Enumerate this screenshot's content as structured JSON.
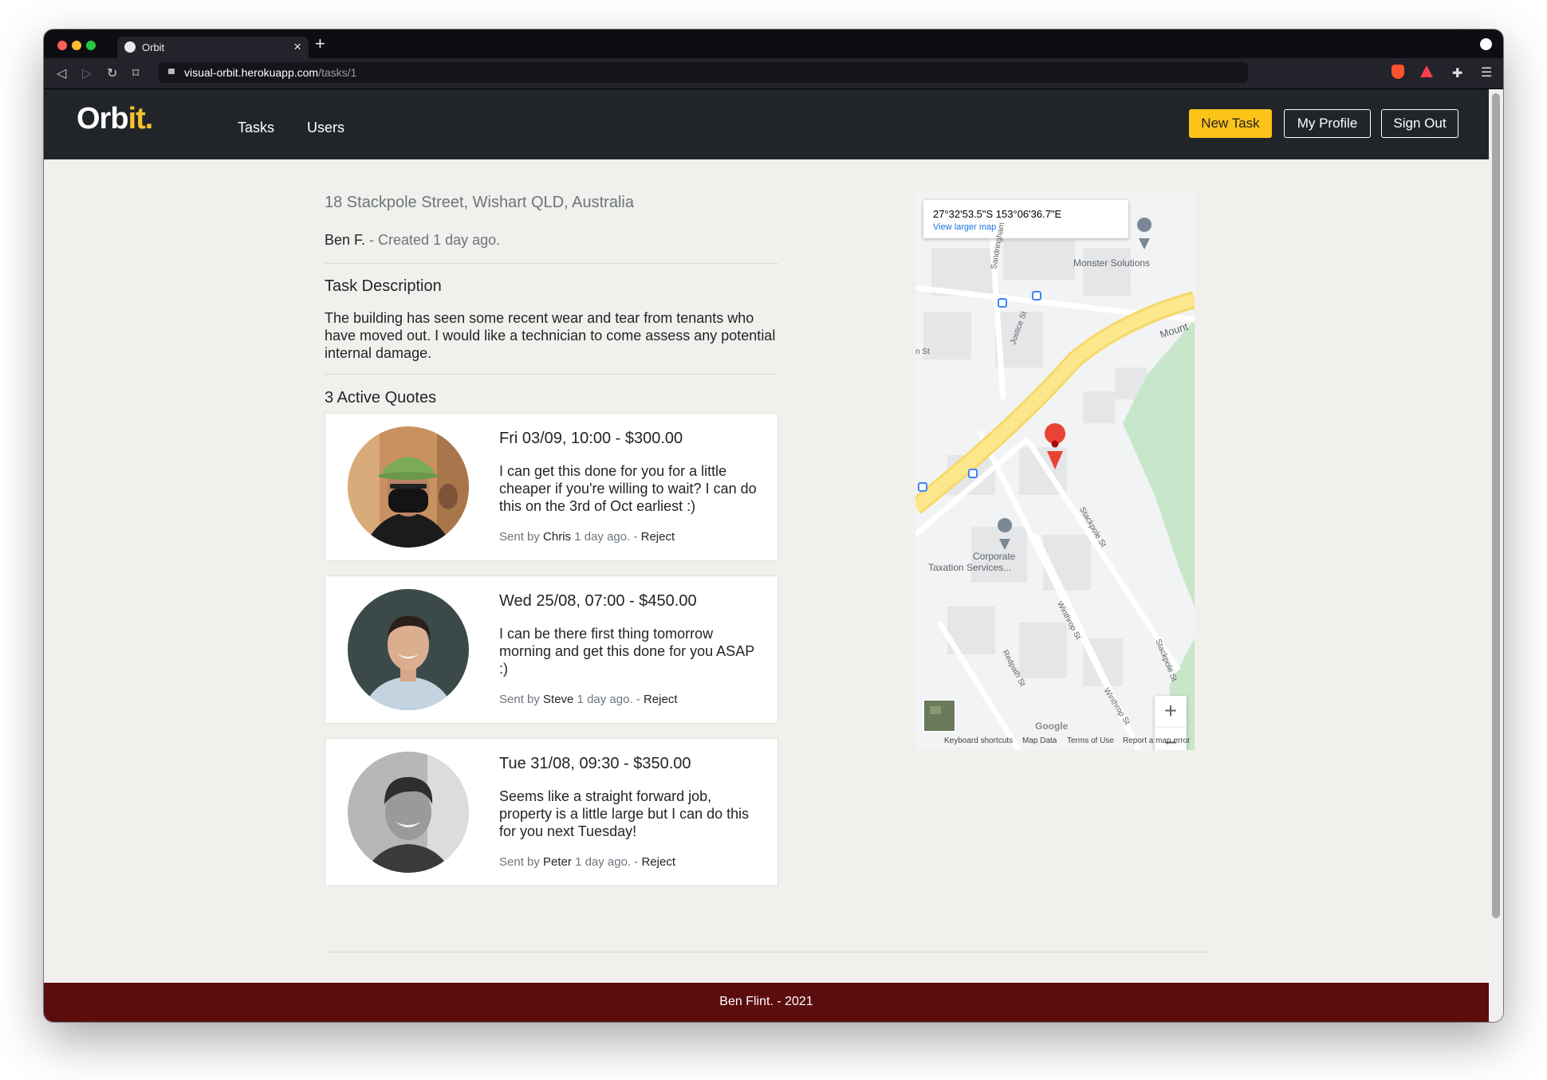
{
  "browser": {
    "tab_title": "Orbit",
    "url_host": "visual-orbit.herokuapp.com",
    "url_path": "/tasks/1"
  },
  "nav": {
    "logo_main": "Orb",
    "logo_accent": "it",
    "logo_dot": ".",
    "links": [
      "Tasks",
      "Users"
    ],
    "new_task": "New Task",
    "my_profile": "My Profile",
    "sign_out": "Sign Out"
  },
  "task": {
    "address": "18 Stackpole Street, Wishart QLD, Australia",
    "author": "Ben F.",
    "created": " - Created 1 day ago.",
    "description_heading": "Task Description",
    "description": "The building has seen some recent wear and tear from tenants who have moved out. I would like a technician to come assess any potential internal damage.",
    "quotes_heading": "3 Active Quotes"
  },
  "quotes": [
    {
      "title": "Fri 03/09, 10:00 - $300.00",
      "message": "I can get this done for you for a little cheaper if you're willing to wait? I can do this on the 3rd of Oct earliest :)",
      "sent_by": "Sent by ",
      "sender": "Chris",
      "age": " 1 day ago. - ",
      "reject": "Reject"
    },
    {
      "title": "Wed 25/08, 07:00 - $450.00",
      "message": "I can be there first thing tomorrow morning and get this done for you ASAP :)",
      "sent_by": "Sent by ",
      "sender": "Steve",
      "age": " 1 day ago. - ",
      "reject": "Reject"
    },
    {
      "title": "Tue 31/08, 09:30 - $350.00",
      "message": "Seems like a straight forward job, property is a little large but I can do this for you next Tuesday!",
      "sent_by": "Sent by ",
      "sender": "Peter",
      "age": " 1 day ago. - ",
      "reject": "Reject"
    }
  ],
  "map": {
    "coords": "27°32'53.5\"S 153°06'36.7\"E",
    "view_larger": "View larger map",
    "poi_1": "Monster Solutions",
    "poi_2a": "Corporate",
    "poi_2b": "Taxation Services...",
    "road_mount": "Mount",
    "road_justice": "Justice St",
    "road_stackpole_1": "Stackpole St",
    "road_stackpole_2": "Stackpole St",
    "road_winthrop_1": "Winthrop St",
    "road_winthrop_2": "Winthrop St",
    "road_redpath": "Redpath St",
    "road_sandringham": "Sandringham",
    "road_n": "n St",
    "zoom_in": "+",
    "zoom_out": "−",
    "google": "Google",
    "keyboard": "Keyboard shortcuts",
    "map_data": "Map Data",
    "terms": "Terms of Use",
    "report": "Report a map error"
  },
  "footer": {
    "text": "Ben Flint. - 2021"
  },
  "colors": {
    "accent": "#fcc318",
    "navbar": "#212529",
    "footer": "#5b0d0e",
    "page_bg": "#f1f0ec",
    "map_pin": "#ea4335"
  }
}
